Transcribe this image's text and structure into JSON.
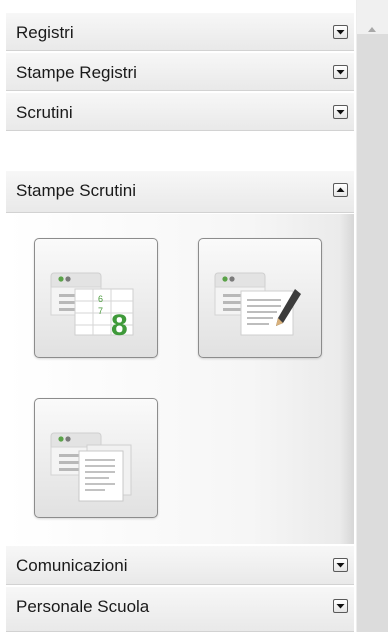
{
  "menu": {
    "sections": [
      {
        "label": "Registri",
        "toggle_icon": "expand-arrow-icon"
      },
      {
        "label": "Stampe Registri",
        "toggle_icon": "expand-arrow-icon"
      },
      {
        "label": "Scrutini",
        "toggle_icon": "expand-arrow-icon"
      },
      {
        "label": "Stampe Scrutini",
        "toggle_icon": "collapse-arrow-icon"
      },
      {
        "label": "Comunicazioni",
        "toggle_icon": "expand-arrow-icon"
      },
      {
        "label": "Personale Scuola",
        "toggle_icon": "expand-arrow-icon"
      }
    ],
    "expanded_section": "Stampe Scrutini",
    "tiles": [
      {
        "icon": "print-grades-icon"
      },
      {
        "icon": "print-edit-document-icon"
      },
      {
        "icon": "print-documents-icon"
      }
    ]
  },
  "colors": {
    "header_bg": "#eeeeee",
    "tile_border": "#8c8c8c",
    "green_accent": "#4a9a3c",
    "scrollbar": "#dcdcdc"
  }
}
